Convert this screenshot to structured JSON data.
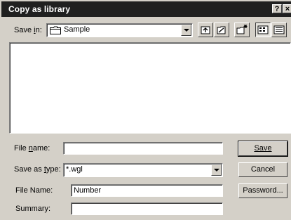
{
  "window": {
    "title": "Copy as library"
  },
  "save_in": {
    "label_pre": "Save ",
    "label_acc": "i",
    "label_post": "n:",
    "value": "Sample"
  },
  "file_name": {
    "label_pre": "File ",
    "label_acc": "n",
    "label_post": "ame:",
    "value": ""
  },
  "save_as_type": {
    "label_pre": "Save as ",
    "label_acc": "t",
    "label_post": "ype:",
    "value": "*.wgl"
  },
  "library_name": {
    "label": "File Name:",
    "value": "Number"
  },
  "summary": {
    "label": "Summary:",
    "value": ""
  },
  "buttons": {
    "save": "Save",
    "cancel": "Cancel",
    "password": "Password..."
  },
  "titlebar": {
    "help": "?",
    "close": "×"
  }
}
